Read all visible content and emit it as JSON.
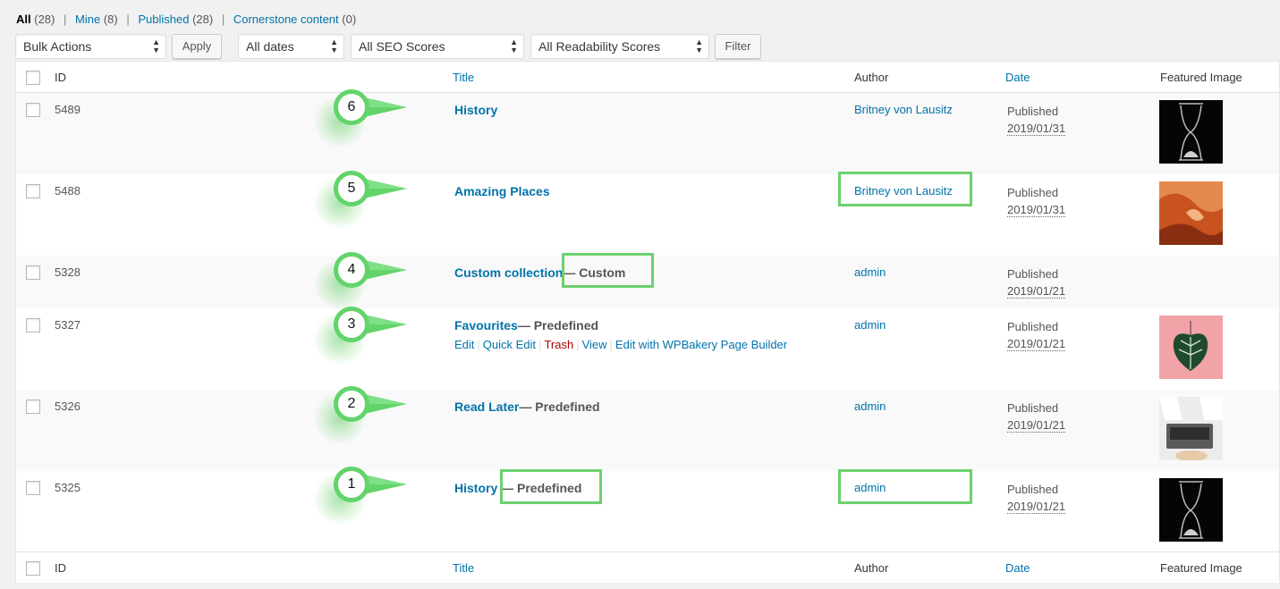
{
  "filters": {
    "views": [
      {
        "label": "All",
        "count": "(28)"
      },
      {
        "label": "Mine",
        "count": "(8)"
      },
      {
        "label": "Published",
        "count": "(28)"
      },
      {
        "label": "Cornerstone content",
        "count": "(0)"
      }
    ],
    "separator": "|",
    "bulk_actions": "Bulk Actions",
    "apply": "Apply",
    "dates": "All dates",
    "seo": "All SEO Scores",
    "readability": "All Readability Scores",
    "filter": "Filter"
  },
  "columns": {
    "id": "ID",
    "title": "Title",
    "author": "Author",
    "date": "Date",
    "image": "Featured Image"
  },
  "rows": [
    {
      "marker": "6",
      "id": "5489",
      "title": "History",
      "state": "",
      "author": "Britney von Lausitz",
      "status": "Published",
      "date": "2019/01/31",
      "image": "hourglass"
    },
    {
      "marker": "5",
      "id": "5488",
      "title": "Amazing Places",
      "state": "",
      "author": "Britney von Lausitz",
      "status": "Published",
      "date": "2019/01/31",
      "image": "canyon"
    },
    {
      "marker": "4",
      "id": "5328",
      "title": "Custom collection",
      "state": "— Custom",
      "author": "admin",
      "status": "Published",
      "date": "2019/01/21",
      "image": ""
    },
    {
      "marker": "3",
      "id": "5327",
      "title": "Favourites",
      "state": "— Predefined",
      "author": "admin",
      "status": "Published",
      "date": "2019/01/21",
      "image": "leaf"
    },
    {
      "marker": "2",
      "id": "5326",
      "title": "Read Later",
      "state": "— Predefined",
      "author": "admin",
      "status": "Published",
      "date": "2019/01/21",
      "image": "laptop"
    },
    {
      "marker": "1",
      "id": "5325",
      "title": "History",
      "state": "— Predefined",
      "author": "admin",
      "status": "Published",
      "date": "2019/01/21",
      "image": "hourglass"
    }
  ],
  "row_actions": {
    "edit": "Edit",
    "quick_edit": "Quick Edit",
    "trash": "Trash",
    "view": "View",
    "builder": "Edit with WPBakery Page Builder",
    "sep": "|"
  },
  "colors": {
    "link": "#0073aa",
    "trash": "#aa0000",
    "highlight": "#6cd16f",
    "marker": "#62d46a"
  }
}
